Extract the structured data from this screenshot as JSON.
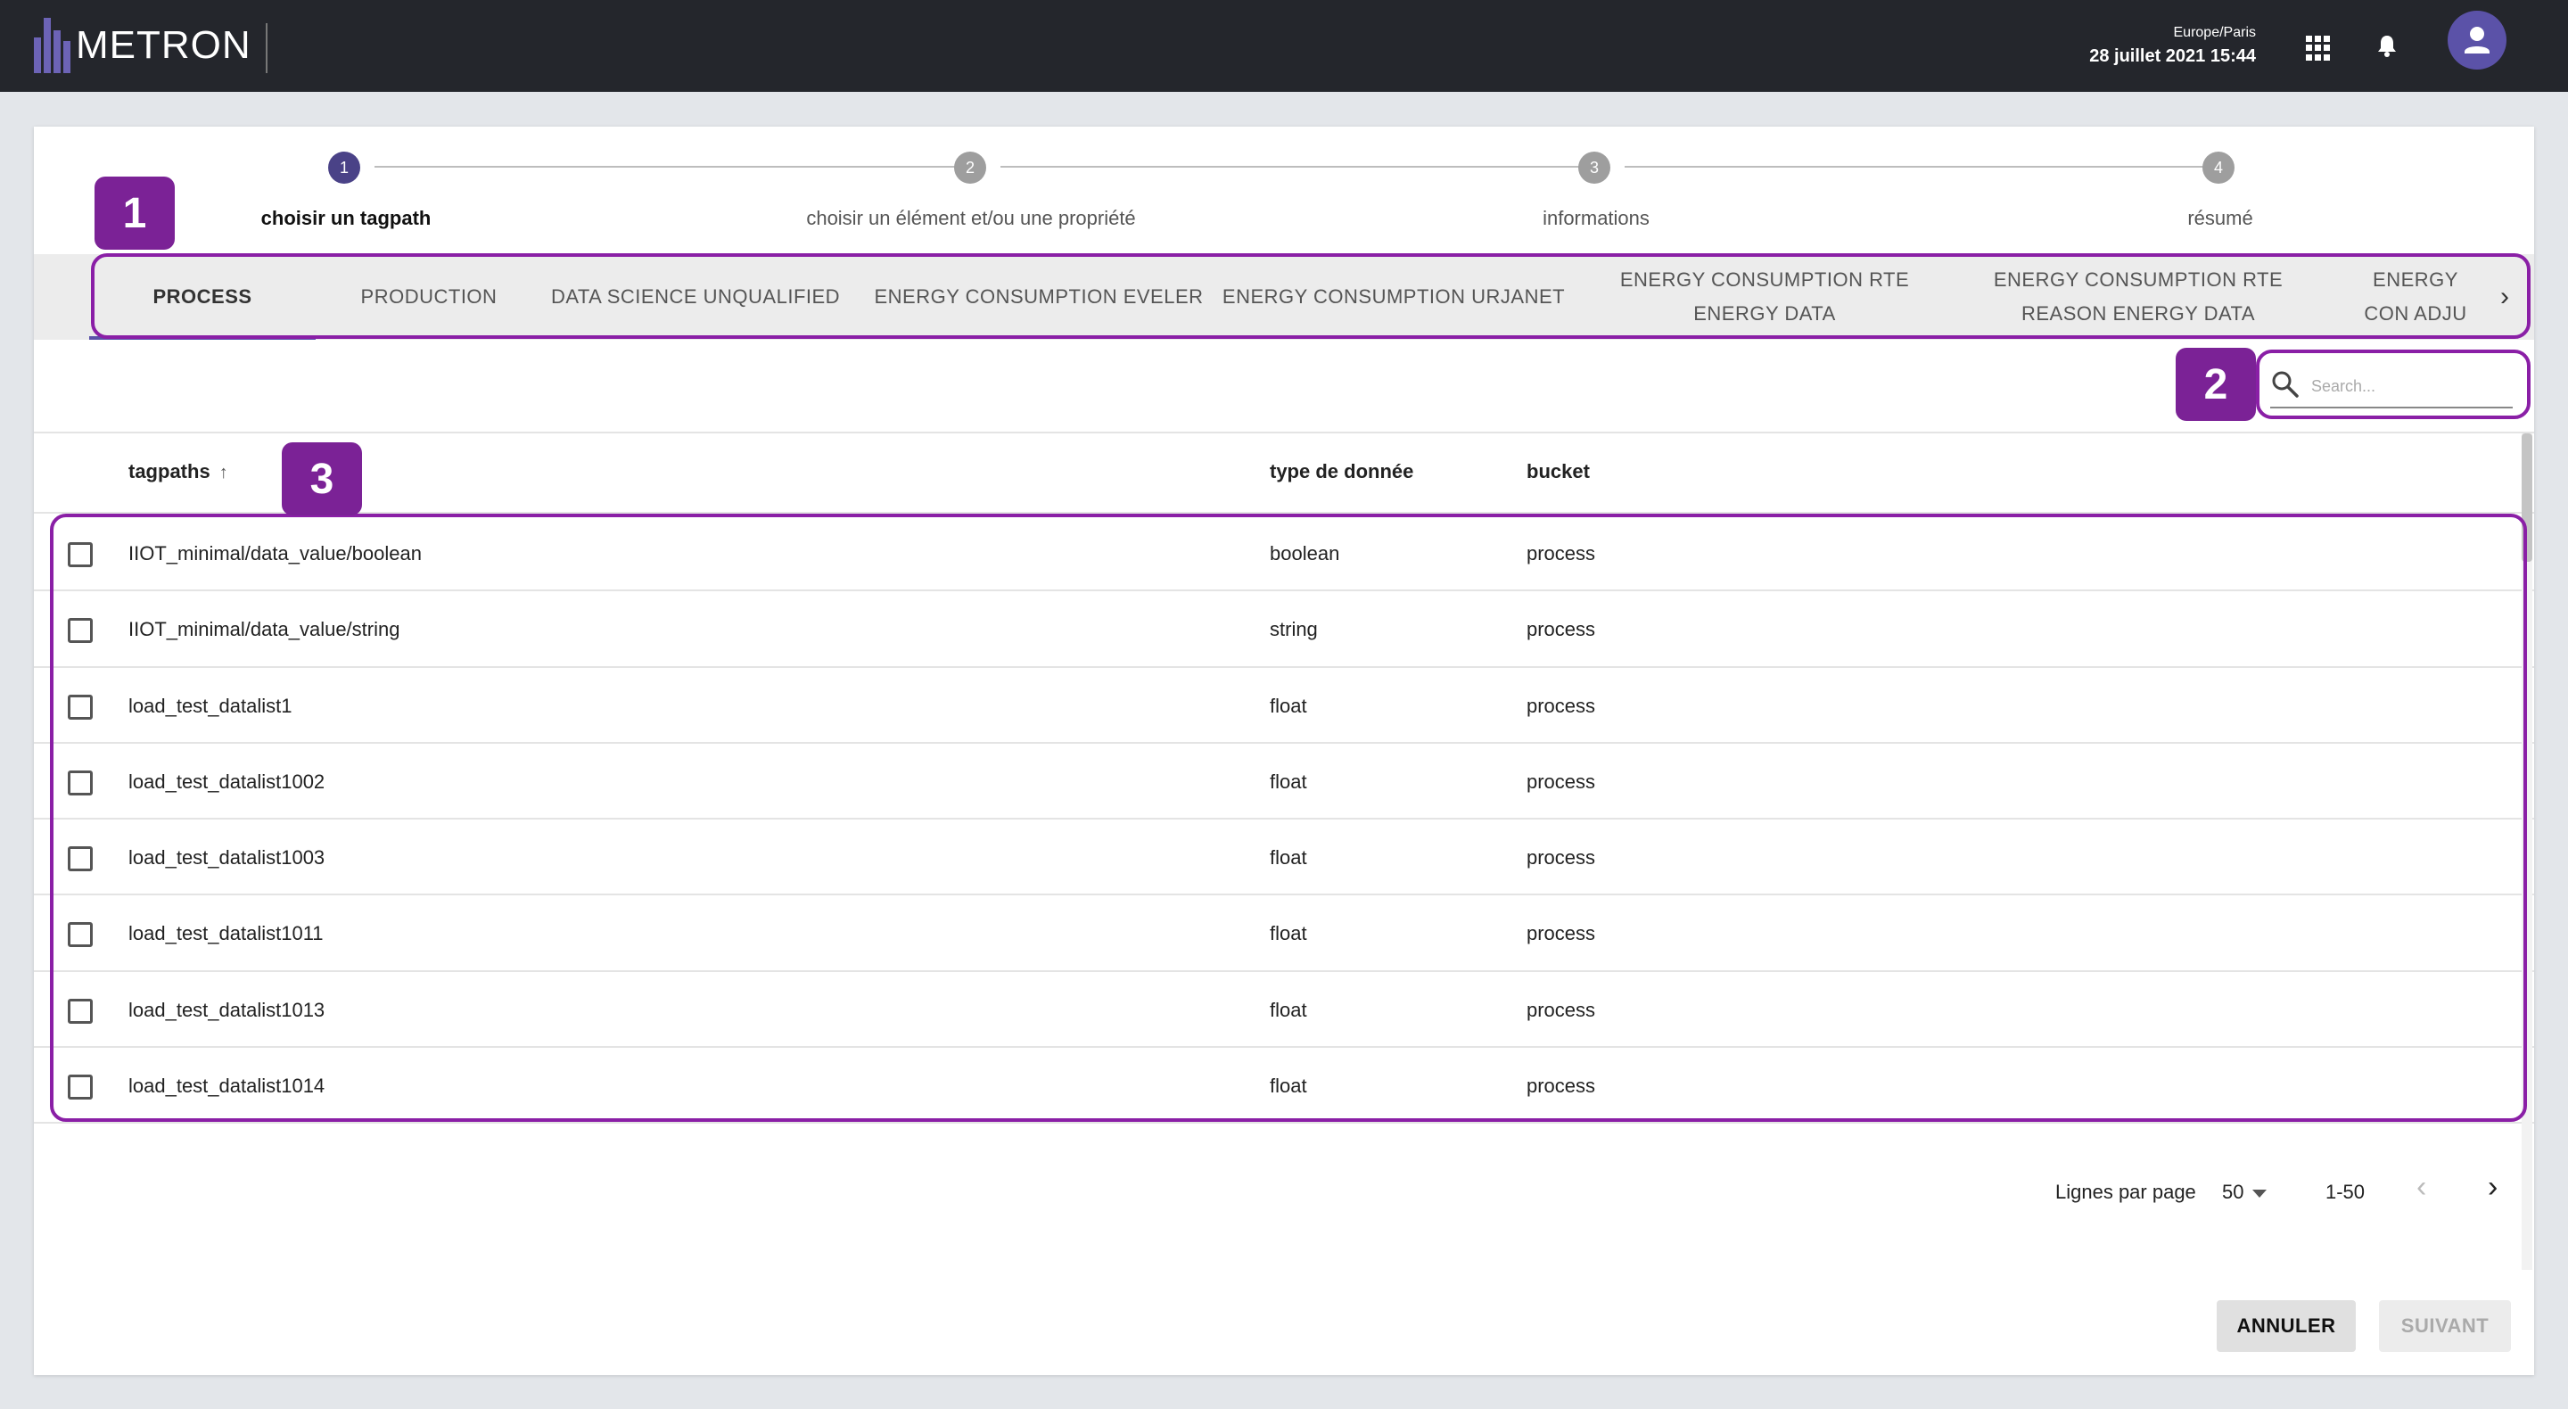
{
  "header": {
    "logo_text": "METRON",
    "timezone": "Europe/Paris",
    "datetime": "28 juillet 2021 15:44",
    "icons": [
      "apps-grid-icon",
      "bell-icon",
      "user-avatar-icon"
    ]
  },
  "stepper": {
    "steps": [
      {
        "number": "1",
        "label": "choisir un tagpath",
        "active": true
      },
      {
        "number": "2",
        "label": "choisir un élément et/ou une propriété",
        "active": false
      },
      {
        "number": "3",
        "label": "informations",
        "active": false
      },
      {
        "number": "4",
        "label": "résumé",
        "active": false
      }
    ]
  },
  "tabs": [
    {
      "label": "PROCESS"
    },
    {
      "label": "PRODUCTION"
    },
    {
      "label": "DATA SCIENCE UNQUALIFIED"
    },
    {
      "label": "ENERGY CONSUMPTION EVELER"
    },
    {
      "label": "ENERGY CONSUMPTION URJANET"
    },
    {
      "label": "ENERGY CONSUMPTION RTE ENERGY DATA"
    },
    {
      "label": "ENERGY CONSUMPTION RTE REASON ENERGY DATA"
    },
    {
      "label": "ENERGY CON ADJU"
    }
  ],
  "search": {
    "placeholder": "Search..."
  },
  "table": {
    "headers": {
      "tagpaths": "tagpaths",
      "type": "type de donnée",
      "bucket": "bucket"
    },
    "rows": [
      {
        "tagpath": "IIOT_minimal/data_value/boolean",
        "type": "boolean",
        "bucket": "process"
      },
      {
        "tagpath": "IIOT_minimal/data_value/string",
        "type": "string",
        "bucket": "process"
      },
      {
        "tagpath": "load_test_datalist1",
        "type": "float",
        "bucket": "process"
      },
      {
        "tagpath": "load_test_datalist1002",
        "type": "float",
        "bucket": "process"
      },
      {
        "tagpath": "load_test_datalist1003",
        "type": "float",
        "bucket": "process"
      },
      {
        "tagpath": "load_test_datalist1011",
        "type": "float",
        "bucket": "process"
      },
      {
        "tagpath": "load_test_datalist1013",
        "type": "float",
        "bucket": "process"
      },
      {
        "tagpath": "load_test_datalist1014",
        "type": "float",
        "bucket": "process"
      }
    ]
  },
  "pagination": {
    "rows_per_page_label": "Lignes par page",
    "rows_per_page": "50",
    "range": "1-50"
  },
  "buttons": {
    "cancel": "ANNULER",
    "next": "SUIVANT"
  },
  "annotations": [
    "1",
    "2",
    "3"
  ],
  "colors": {
    "accent": "#5b52a8",
    "annotation": "#7b2296",
    "topbar": "#24262c"
  }
}
